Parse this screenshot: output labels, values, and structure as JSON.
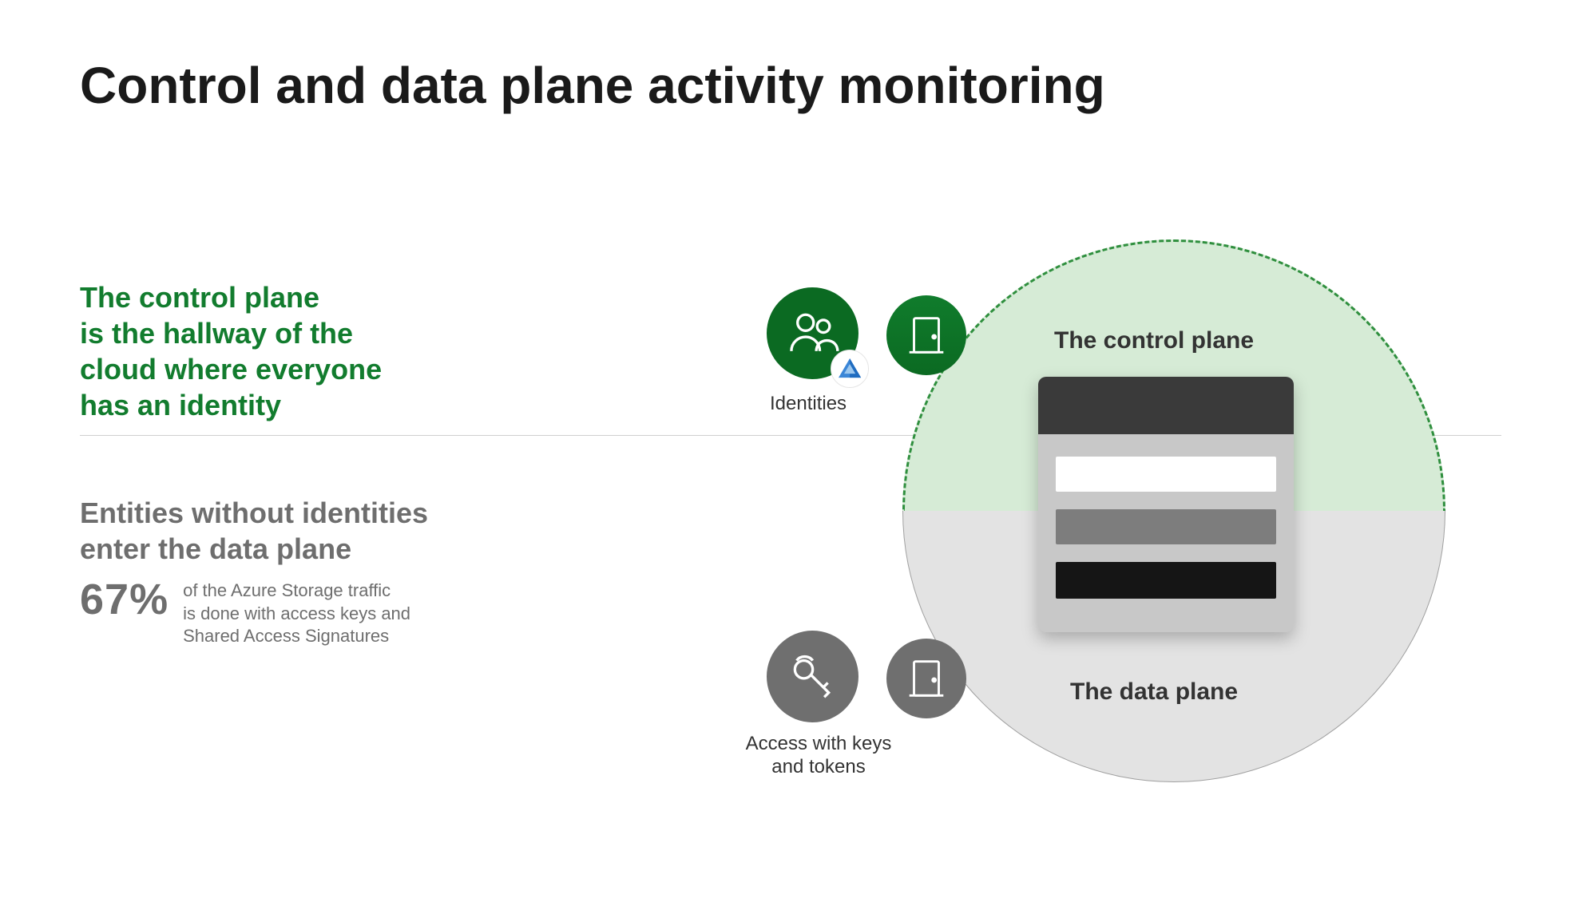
{
  "title": "Control and data plane activity monitoring",
  "control_plane": {
    "desc": "The control plane\nis the hallway of the\ncloud where everyone\nhas an identity",
    "label": "The control plane",
    "identities_label": "Identities"
  },
  "data_plane": {
    "subtitle": "Entities without identities\nenter the data plane",
    "stat_value": "67%",
    "stat_desc": "of the Azure Storage traffic\nis done with access keys and\nShared Access Signatures",
    "label": "The data plane",
    "access_label": "Access with keys\nand tokens"
  }
}
